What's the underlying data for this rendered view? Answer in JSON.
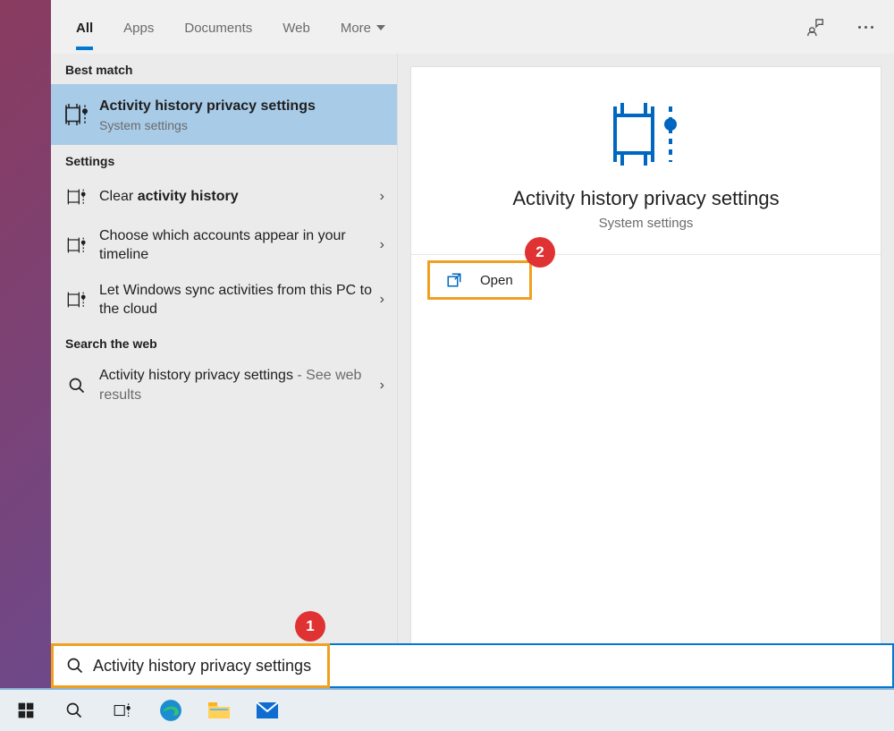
{
  "tabs": {
    "all": "All",
    "apps": "Apps",
    "documents": "Documents",
    "web": "Web",
    "more": "More"
  },
  "sections": {
    "best_match": "Best match",
    "settings": "Settings",
    "search_web": "Search the web"
  },
  "results": {
    "best_match": {
      "title": "Activity history privacy settings",
      "sub": "System settings"
    },
    "settings": [
      {
        "prefix": "Clear ",
        "bold": "activity history"
      },
      {
        "full": "Choose which accounts appear in your timeline"
      },
      {
        "full": "Let Windows sync activities from this PC to the cloud"
      }
    ],
    "web": {
      "title": "Activity history privacy settings",
      "suffix": " - See web results"
    }
  },
  "detail": {
    "title": "Activity history privacy settings",
    "sub": "System settings",
    "open": "Open"
  },
  "search": {
    "value": "Activity history privacy settings"
  },
  "annotations": {
    "b1": "1",
    "b2": "2"
  }
}
